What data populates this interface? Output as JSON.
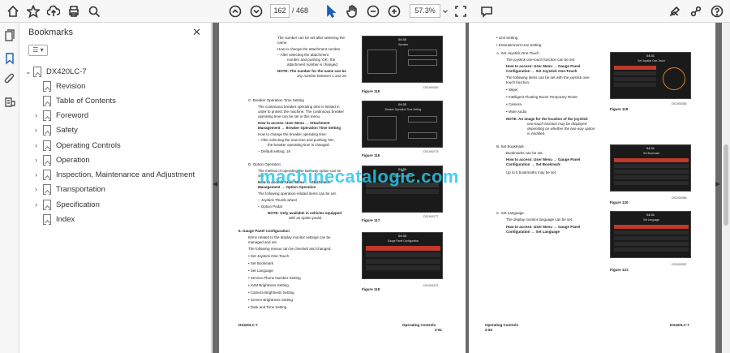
{
  "toolbar": {
    "current_page": "162",
    "total_pages": "/ 468",
    "zoom": "57.3%"
  },
  "bookmarks": {
    "title": "Bookmarks",
    "root": "DX420LC-7",
    "items": [
      {
        "label": "Revision",
        "expandable": false
      },
      {
        "label": "Table of Contents",
        "expandable": false
      },
      {
        "label": "Foreword",
        "expandable": true
      },
      {
        "label": "Safety",
        "expandable": true
      },
      {
        "label": "Operating Controls",
        "expandable": true
      },
      {
        "label": "Operation",
        "expandable": true
      },
      {
        "label": "Inspection, Maintenance and Adjustment",
        "expandable": true
      },
      {
        "label": "Transportation",
        "expandable": true
      },
      {
        "label": "Specification",
        "expandable": true
      },
      {
        "label": "Index",
        "expandable": false
      }
    ]
  },
  "page_left": {
    "l1": "The number can be set after selecting the",
    "l2": "name.",
    "l3": "How to change the attachment number",
    "l4": "–    After selecting the attachment",
    "l5": "number and pushing 'OK', the",
    "l6": "attachment number is changed.",
    "l7": "NOTE:    The number for the name can be",
    "l8": "any number between 1 and 20.",
    "secC": "C.    Breaker Operation Time Setting",
    "c1": "The continuous breaker operating time is limited in",
    "c2": "order to protect the machine. The continuous breaker",
    "c3": "operating time can be set in this menu.",
    "c4": "How to access: User Menu → Attachment",
    "c5": "Management → Breaker Operation Time Setting",
    "c6": "How to change the breaker operating time:",
    "c7": "–    After selecting the new time and pushing 'OK',",
    "c8": "the breaker operating time is changed.",
    "c9": "–    Default setting: 16",
    "secD": "D.    Option Operation",
    "d1": "The method of operating the two-way option can be",
    "d2": "set.",
    "d3": "How to access: User Menu → Attachment",
    "d4": "Management → Option Operation",
    "d5": "The following operation-related items can be set.",
    "d6": "–    Joystick Thumb wheel",
    "d7": "–    Option Pedal",
    "d8": "NOTE:    Only available in vehicles equipped",
    "d9": "with an option pedal.",
    "sec5": "5.    Gauge Panel Configuration",
    "g1": "Items related to the display monitor settings can be",
    "g2": "managed and set.",
    "g3": "The following menus can be checked and changed.",
    "g4": "•    Set Joystick One-Touch",
    "g5": "•    Set Bookmark",
    "g6": "•    Set Language",
    "g7": "•    Service Phone Number Setting",
    "g8": "•    AVM Brightness Setting",
    "g9": "•    Camera Brightness Setting",
    "g10": "•    Screen Brightness Setting",
    "g11": "•    Date and Time Setting",
    "fig115": "Figure 115",
    "fig116": "Figure 116",
    "fig117": "Figure 117",
    "fig118": "Figure 118",
    "code115": "DS1900392",
    "code116": "DS1900775",
    "code117": "DS1900777",
    "code118": "DS1901872",
    "footer_left": "DX420LC-7",
    "footer_right": "Operating Controls",
    "footer_page": "2-61",
    "scr115_title": "Operator",
    "scr116_title": "Breaker Operation Time Setting",
    "scr117_title": "Option Operation",
    "scr118_title": "Gauge Panel Configuration",
    "time": "04:30"
  },
  "page_right": {
    "r1": "•    Unit Setting",
    "r2": "•    Entertainment Use Setting",
    "secA": "A.    Set Joystick One-Touch",
    "a1": "The joystick one-touch function can be set.",
    "a2": "How to access: User Menu → Gauge Panel",
    "a3": "Configuration → Set Joystick One-Touch",
    "a4": "The following items can be set with the joystick one-",
    "a5": "touch function.",
    "a6": "•    Wiper",
    "a7": "•    Intelligent Floating Boom Temporary Reset",
    "a8": "•    Camera",
    "a9": "•    Mute Audio",
    "a10": "NOTE:    An image for the location of the joystick",
    "a11": "one-touch function may be displayed",
    "a12": "depending on whether the two-way option",
    "a13": "is installed.",
    "secB": "B.    Set Bookmark",
    "b1": "Bookmarks can be set.",
    "b2": "How to access: User Menu → Gauge Panel",
    "b3": "Configuration → Set Bookmark",
    "b4": "Up to 5 bookmarks may be set.",
    "secC": "C.    Set Language",
    "c1": "The display monitor language can be set.",
    "c2": "How to access: User Menu → Gauge Panel",
    "c3": "Configuration → Set Language",
    "fig119": "Figure 119",
    "fig120": "Figure 120",
    "fig121": "Figure 121",
    "code119": "DS1900355",
    "code120": "DS1900356",
    "code121": "DS1900357",
    "footer_left": "Operating Controls",
    "footer_right": "DX420LC-7",
    "footer_page": "2-62",
    "scr119_title": "Set Joystick One-Touch",
    "scr120_title": "Set Bookmark",
    "scr121_title": "Set Language",
    "time": "04:31"
  },
  "watermark": "machinecatalogic.com"
}
